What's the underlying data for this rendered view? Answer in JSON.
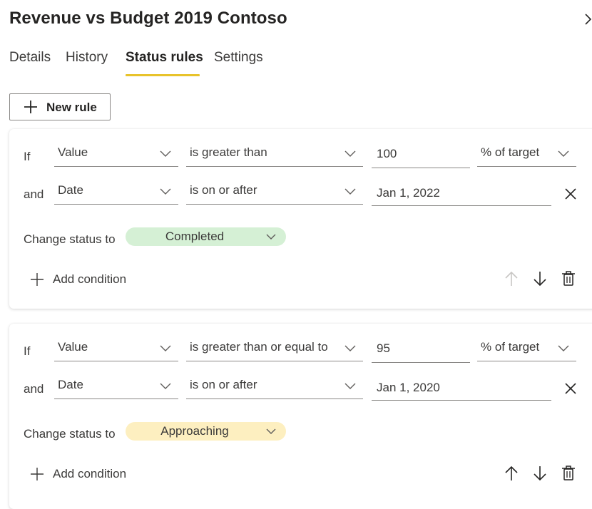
{
  "panel": {
    "title": "Revenue vs Budget 2019 Contoso"
  },
  "tabs": [
    {
      "label": "Details"
    },
    {
      "label": "History"
    },
    {
      "label": "Status rules"
    },
    {
      "label": "Settings"
    }
  ],
  "toolbar": {
    "new_rule_label": "New rule"
  },
  "rules": [
    {
      "if_label": "If",
      "field": "Value",
      "operator": "is greater than",
      "value": "100",
      "unit": "% of target",
      "and_label": "and",
      "and_field": "Date",
      "and_operator": "is on or after",
      "and_value": "Jan 1, 2022",
      "change_status_label": "Change status to",
      "status": "Completed",
      "status_color": "#d5f0d5",
      "add_condition_label": "Add condition"
    },
    {
      "if_label": "If",
      "field": "Value",
      "operator": "is greater than or equal to",
      "value": "95",
      "unit": "% of target",
      "and_label": "and",
      "and_field": "Date",
      "and_operator": "is on or after",
      "and_value": "Jan 1, 2020",
      "change_status_label": "Change status to",
      "status": "Approaching",
      "status_color": "#fdefc0",
      "add_condition_label": "Add condition"
    }
  ],
  "colors": {
    "tab_underline": "#e8c32b",
    "border": "#8a8886",
    "text": "#3b3a39"
  }
}
